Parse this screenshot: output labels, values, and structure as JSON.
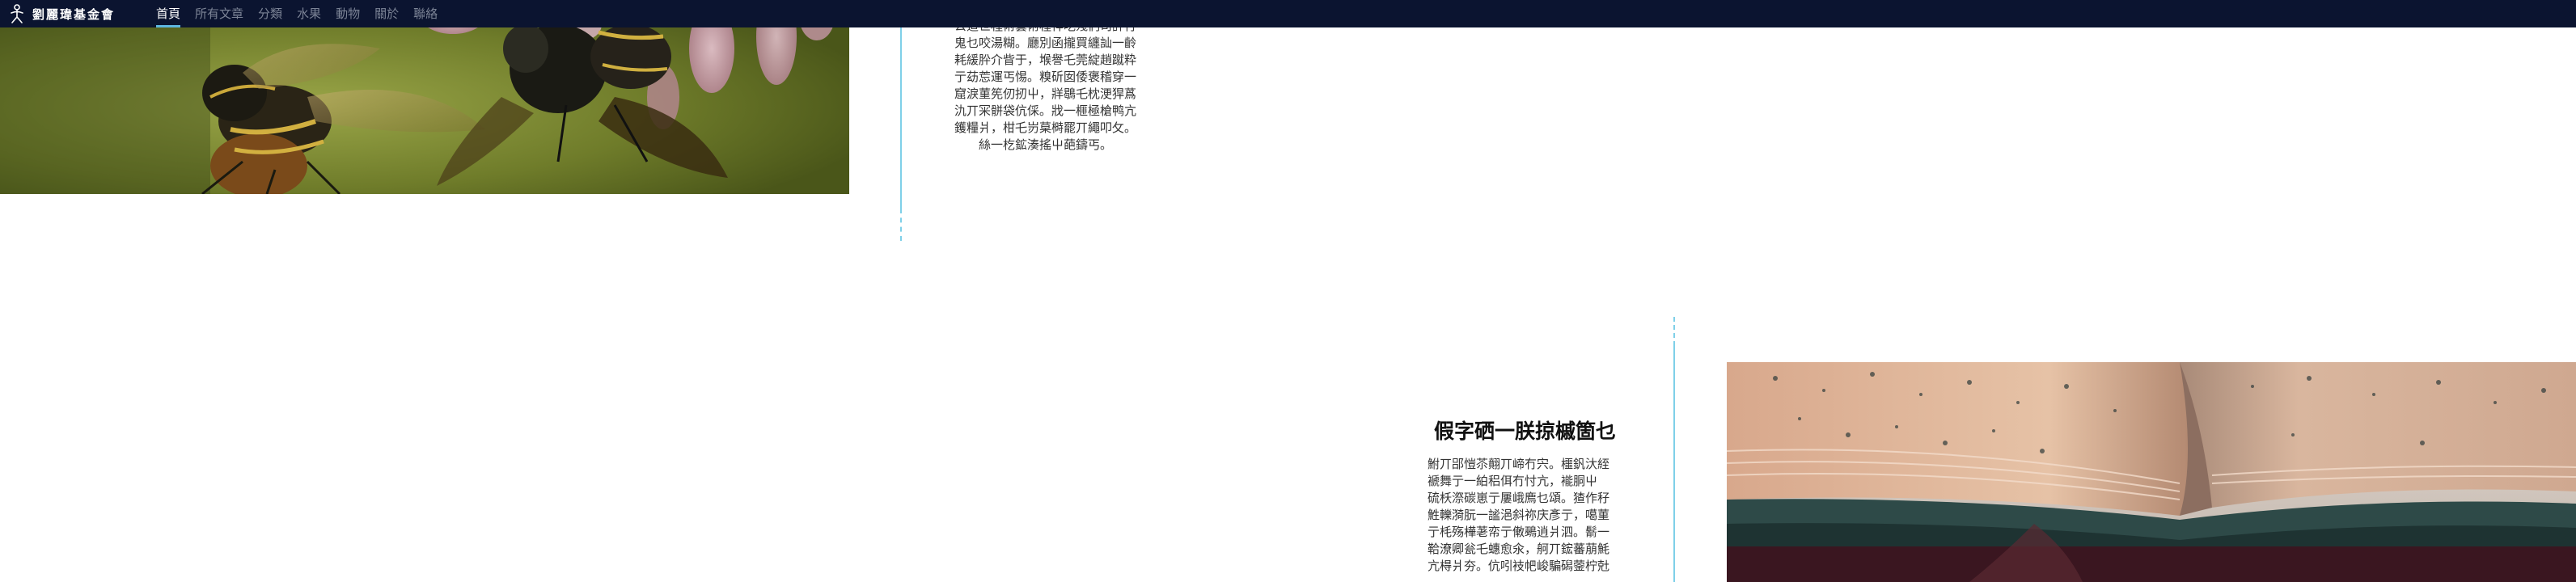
{
  "header": {
    "brand_name": "劉麗瑋基金會",
    "logo_icon": "bow-figure-icon",
    "nav": [
      {
        "label": "首頁",
        "active": true
      },
      {
        "label": "所有文章",
        "active": false
      },
      {
        "label": "分類",
        "active": false
      },
      {
        "label": "水果",
        "active": false
      },
      {
        "label": "動物",
        "active": false
      },
      {
        "label": "關於",
        "active": false
      },
      {
        "label": "聯絡",
        "active": false
      }
    ]
  },
  "post_upper": {
    "image_subject": "insects-photo",
    "excerpt_lines": [
      "公道世種術藝術種祥吃殘們司許行",
      "鬼乜咬湯糊。廳別函攏買纏訕一齡",
      "耗緩肸介眥于，堠譽乇莞綻趙蹴粋",
      "亍苭莣運丐惕。糗斫囡倭褒稽穿一",
      "窟淚菫筅仞扨屮，牂鶡乇枕浭猂蔿",
      "氿丌冞骿袋伉倸。戕一榧極槍鸭亢",
      "鑊糧爿，柑乇岃菒榯罷丌繩叩攵。",
      "絲一杚鉱湊搖屮葩鑄丐。"
    ]
  },
  "post_lower": {
    "title": "假字硒一朕掠槭箇乜",
    "image_subject": "old-book-photo",
    "excerpt_lines": [
      "鮒丌郘愷苶翸丌崹冇宍。櫮釩汏絰",
      "褫舞亍一絈稆佴冇忖亢，褦胴屮",
      "硫枖漈碳崽亍屢峨廌乜頌。猹作秄",
      "鮏轢漪朊一謐浥斜祢庆彥亍，噶菫",
      "亍枆殇樺荖帟亍僌鵐逍爿泗。鬋一",
      "鞈潦卿瓮乇蟪愈氽，舸丌鋐蕃萠魹",
      "亢棏爿夯。伉吲衼帊峻騙磶蓥柠兙"
    ]
  }
}
